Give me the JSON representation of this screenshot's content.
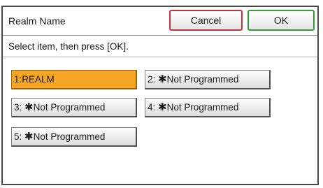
{
  "title_bar": {
    "title": "Realm Name",
    "cancel_label": "Cancel",
    "ok_label": "OK"
  },
  "message": "Select item, then press [OK].",
  "items": [
    {
      "number": "1",
      "separator": ":",
      "label": "REALM",
      "selected": true
    },
    {
      "number": "2",
      "separator": ": ",
      "star": "✱",
      "label": "Not Programmed",
      "selected": false
    },
    {
      "number": "3",
      "separator": ": ",
      "star": "✱",
      "label": "Not Programmed",
      "selected": false
    },
    {
      "number": "4",
      "separator": ": ",
      "star": "✱",
      "label": "Not Programmed",
      "selected": false
    },
    {
      "number": "5",
      "separator": ": ",
      "star": "✱",
      "label": "Not Programmed",
      "selected": false
    }
  ],
  "colors": {
    "selected_item": "#f6a524",
    "cancel_border": "#c8323c",
    "ok_border": "#3a9a3e"
  }
}
